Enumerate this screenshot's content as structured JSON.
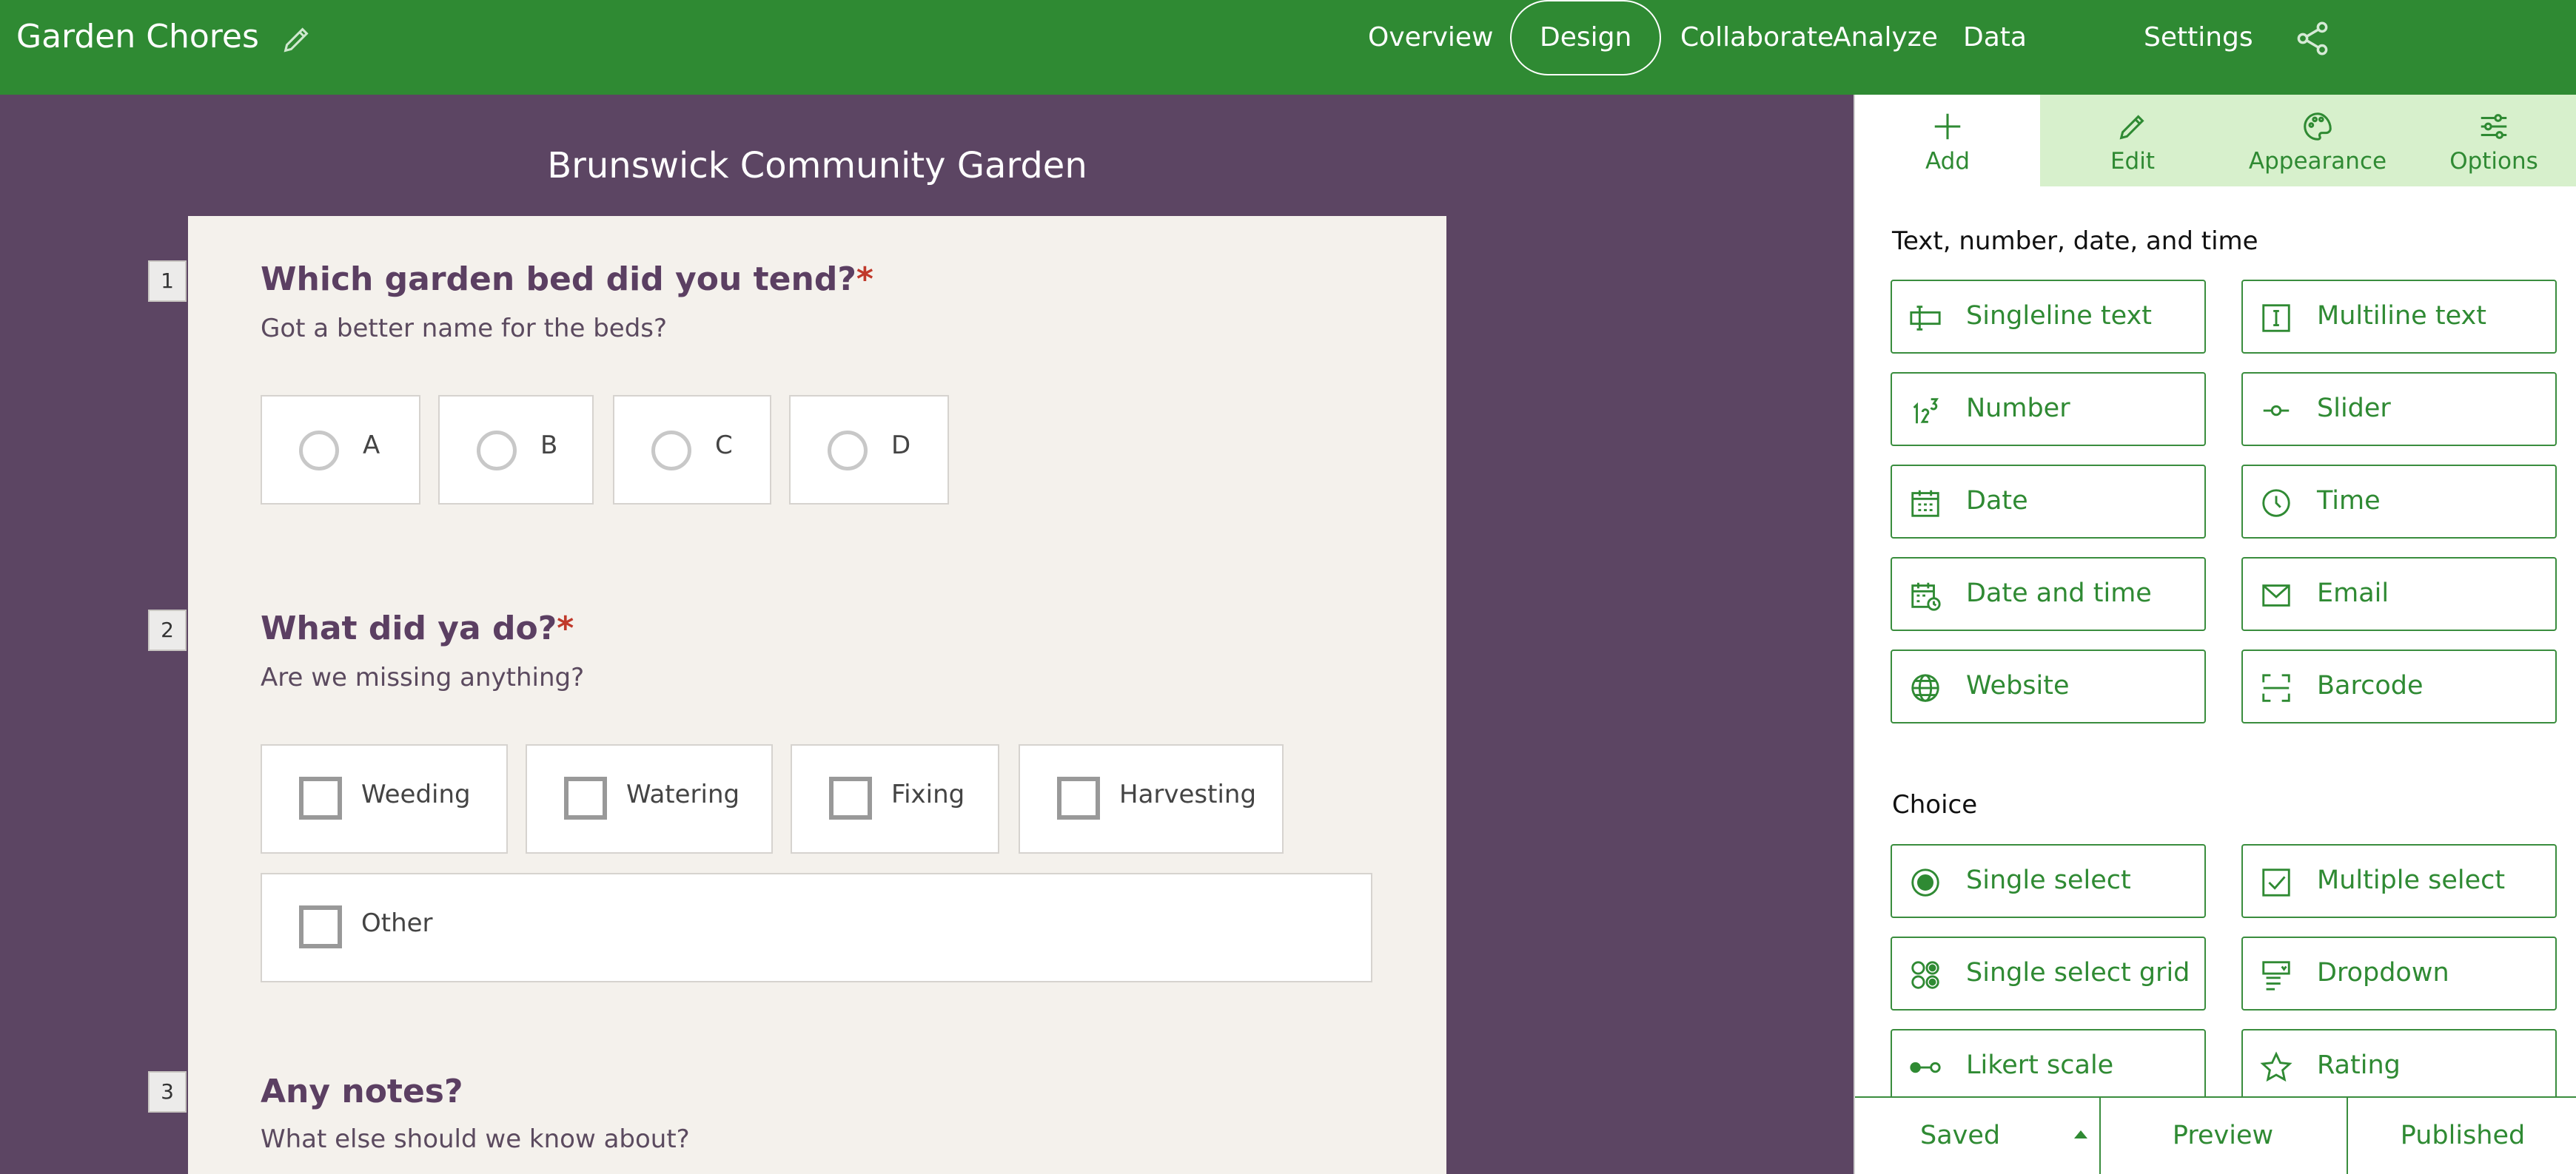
{
  "app": {
    "title": "Garden Chores"
  },
  "nav": {
    "items": [
      {
        "label": "Overview",
        "active": false
      },
      {
        "label": "Design",
        "active": true
      },
      {
        "label": "Collaborate",
        "active": false
      },
      {
        "label": "Analyze",
        "active": false
      },
      {
        "label": "Data",
        "active": false
      },
      {
        "label": "Settings",
        "active": false
      }
    ]
  },
  "survey": {
    "title": "Brunswick Community Garden",
    "questions": [
      {
        "number": "1",
        "title": "Which garden bed did you tend?",
        "required_mark": "*",
        "description": "Got a better name for the beds?",
        "type": "single-select",
        "options": [
          "A",
          "B",
          "C",
          "D"
        ]
      },
      {
        "number": "2",
        "title": "What did ya do?",
        "required_mark": "*",
        "description": "Are we missing anything?",
        "type": "multiple-select",
        "options": [
          "Weeding",
          "Watering",
          "Fixing",
          "Harvesting",
          "Other"
        ]
      },
      {
        "number": "3",
        "title": "Any notes?",
        "description": "What else should we know about?"
      }
    ]
  },
  "panel": {
    "tabs": [
      {
        "label": "Add",
        "icon": "plus-icon",
        "active": true
      },
      {
        "label": "Edit",
        "icon": "pencil-icon",
        "active": false
      },
      {
        "label": "Appearance",
        "icon": "palette-icon",
        "active": false
      },
      {
        "label": "Options",
        "icon": "sliders-icon",
        "active": false
      }
    ],
    "sections": [
      {
        "title": "Text, number, date, and time",
        "tools": [
          {
            "label": "Singleline text",
            "icon": "singleline-text-icon"
          },
          {
            "label": "Multiline text",
            "icon": "multiline-text-icon"
          },
          {
            "label": "Number",
            "icon": "number-icon"
          },
          {
            "label": "Slider",
            "icon": "slider-icon"
          },
          {
            "label": "Date",
            "icon": "calendar-icon"
          },
          {
            "label": "Time",
            "icon": "clock-icon"
          },
          {
            "label": "Date and time",
            "icon": "calendar-clock-icon"
          },
          {
            "label": "Email",
            "icon": "envelope-icon"
          },
          {
            "label": "Website",
            "icon": "globe-icon"
          },
          {
            "label": "Barcode",
            "icon": "barcode-scan-icon"
          }
        ]
      },
      {
        "title": "Choice",
        "tools": [
          {
            "label": "Single select",
            "icon": "radio-icon"
          },
          {
            "label": "Multiple select",
            "icon": "checkbox-icon"
          },
          {
            "label": "Single select grid",
            "icon": "grid-radio-icon"
          },
          {
            "label": "Dropdown",
            "icon": "dropdown-icon"
          },
          {
            "label": "Likert scale",
            "icon": "likert-icon"
          },
          {
            "label": "Rating",
            "icon": "star-icon"
          }
        ]
      }
    ],
    "footer": {
      "saved": "Saved",
      "preview": "Preview",
      "published": "Published"
    }
  },
  "colors": {
    "brand": "#2f8a33",
    "canvas": "#5c4563",
    "card": "#f4f1ec",
    "tab_inactive": "#d7f0cc",
    "required": "#c0392b"
  }
}
